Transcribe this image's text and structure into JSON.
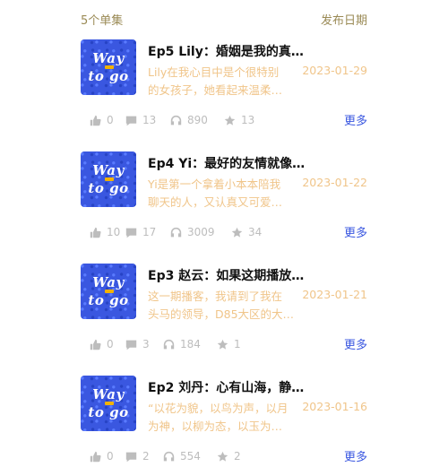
{
  "header": {
    "count_label": "5个单集",
    "date_label": "发布日期"
  },
  "episodes": [
    {
      "cover_line1": "Way",
      "cover_line2": "to go",
      "title": "Ep5 Lily：婚姻是我的真…",
      "desc_line1": "Lily在我心目中是个很特别",
      "desc_line2": "的女孩子，她看起来温柔…",
      "date": "2023-01-29",
      "likes": "0",
      "comments": "13",
      "listens": "890",
      "stars": "13",
      "more": "更多"
    },
    {
      "cover_line1": "Way",
      "cover_line2": "to go",
      "title": "Ep4 Yi：最好的友情就像…",
      "desc_line1": "Yi是第一个拿着小本本陪我",
      "desc_line2": "聊天的人，又认真又可爱…",
      "date": "2023-01-22",
      "likes": "10",
      "comments": "17",
      "listens": "3009",
      "stars": "34",
      "more": "更多"
    },
    {
      "cover_line1": "Way",
      "cover_line2": "to go",
      "title": "Ep3 赵云：如果这期播放…",
      "desc_line1": "这一期播客，我请到了我在",
      "desc_line2": "头马的领导，D85大区的大…",
      "date": "2023-01-21",
      "likes": "0",
      "comments": "3",
      "listens": "184",
      "stars": "1",
      "more": "更多"
    },
    {
      "cover_line1": "Way",
      "cover_line2": "to go",
      "title": "Ep2 刘丹：心有山海，静…",
      "desc_line1": "“以花为貌，以鸟为声，以月",
      "desc_line2": "为神，以柳为态，以玉为…",
      "date": "2023-01-16",
      "likes": "0",
      "comments": "2",
      "listens": "554",
      "stars": "2",
      "more": "更多"
    }
  ],
  "colors": {
    "cover": "#3a57e0",
    "accent": "#3a57e0",
    "muted": "#f0c58a",
    "header": "#9a8a55"
  },
  "icons": [
    "thumbs-up-icon",
    "comment-icon",
    "headphones-icon",
    "star-icon"
  ]
}
